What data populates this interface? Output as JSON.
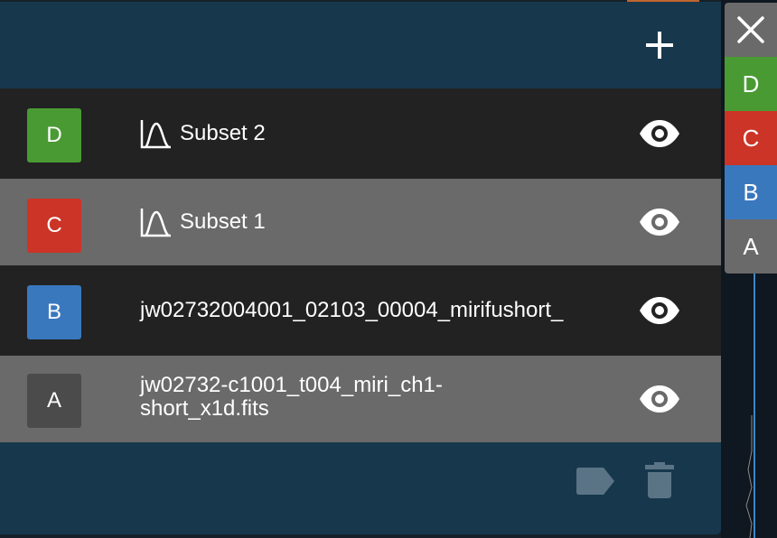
{
  "colors": {
    "panel": "#17384c",
    "row_dark": "#222222",
    "row_light": "#6a6a6a",
    "green": "#4a9a34",
    "red": "#cc3427",
    "blue": "#3a78be",
    "gray": "#4b4b4b"
  },
  "header": {
    "add_icon": "plus-icon"
  },
  "layers": [
    {
      "badge": "D",
      "badge_color": "#4a9a34",
      "label": "Subset 2",
      "icon": "spectral-subset-icon",
      "visible_icon": "eye-icon"
    },
    {
      "badge": "C",
      "badge_color": "#cc3427",
      "label": "Subset 1",
      "icon": "spectral-subset-icon",
      "visible_icon": "eye-icon"
    },
    {
      "badge": "B",
      "badge_color": "#3a78be",
      "label": "jw02732004001_02103_00004_mirifushort_",
      "visible_icon": "eye-icon"
    },
    {
      "badge": "A",
      "badge_color": "#4b4b4b",
      "label_line1": "jw02732-c1001_t004_miri_ch1-",
      "label_line2": "short_x1d.fits",
      "visible_icon": "eye-icon"
    }
  ],
  "footer": {
    "tag_icon": "tag-icon",
    "delete_icon": "trash-icon"
  },
  "mini_column": {
    "close_icon": "close-icon",
    "items": [
      {
        "label": "D",
        "color": "#4a9a34"
      },
      {
        "label": "C",
        "color": "#cc3427"
      },
      {
        "label": "B",
        "color": "#3a78be"
      },
      {
        "label": "A",
        "color": "#6a6a6a"
      }
    ]
  }
}
